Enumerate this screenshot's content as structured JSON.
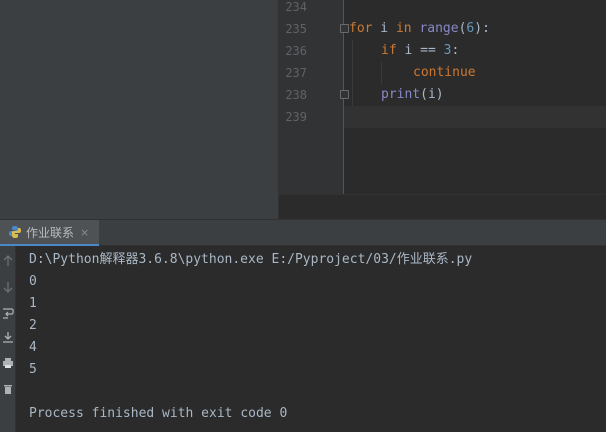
{
  "editor": {
    "line_numbers": [
      "234",
      "235",
      "236",
      "237",
      "238",
      "239"
    ],
    "code": {
      "l235": {
        "kw1": "for",
        "var": " i ",
        "kw2": "in",
        "fn": " range",
        "open": "(",
        "num": "6",
        "close": "):"
      },
      "l236": {
        "kw": "if",
        "rest": " i == ",
        "num": "3",
        "colon": ":"
      },
      "l237": {
        "kw": "continue"
      },
      "l238": {
        "fn": "print",
        "args": "(i)"
      }
    }
  },
  "run": {
    "tab_label": "作业联系",
    "tab_close": "×",
    "console_lines": [
      "D:\\Python解释器3.6.8\\python.exe E:/Pyproject/03/作业联系.py",
      "0",
      "1",
      "2",
      "4",
      "5",
      "",
      "Process finished with exit code 0"
    ]
  },
  "colors": {
    "keyword": "#cc7832",
    "builtin": "#8888c6",
    "number": "#6897bb",
    "text": "#a9b7c6",
    "line_number": "#606366"
  },
  "icons": [
    "python-file-icon",
    "arrow-up-icon",
    "arrow-down-icon",
    "soft-wrap-icon",
    "scroll-to-end-icon",
    "print-icon",
    "trash-icon"
  ]
}
